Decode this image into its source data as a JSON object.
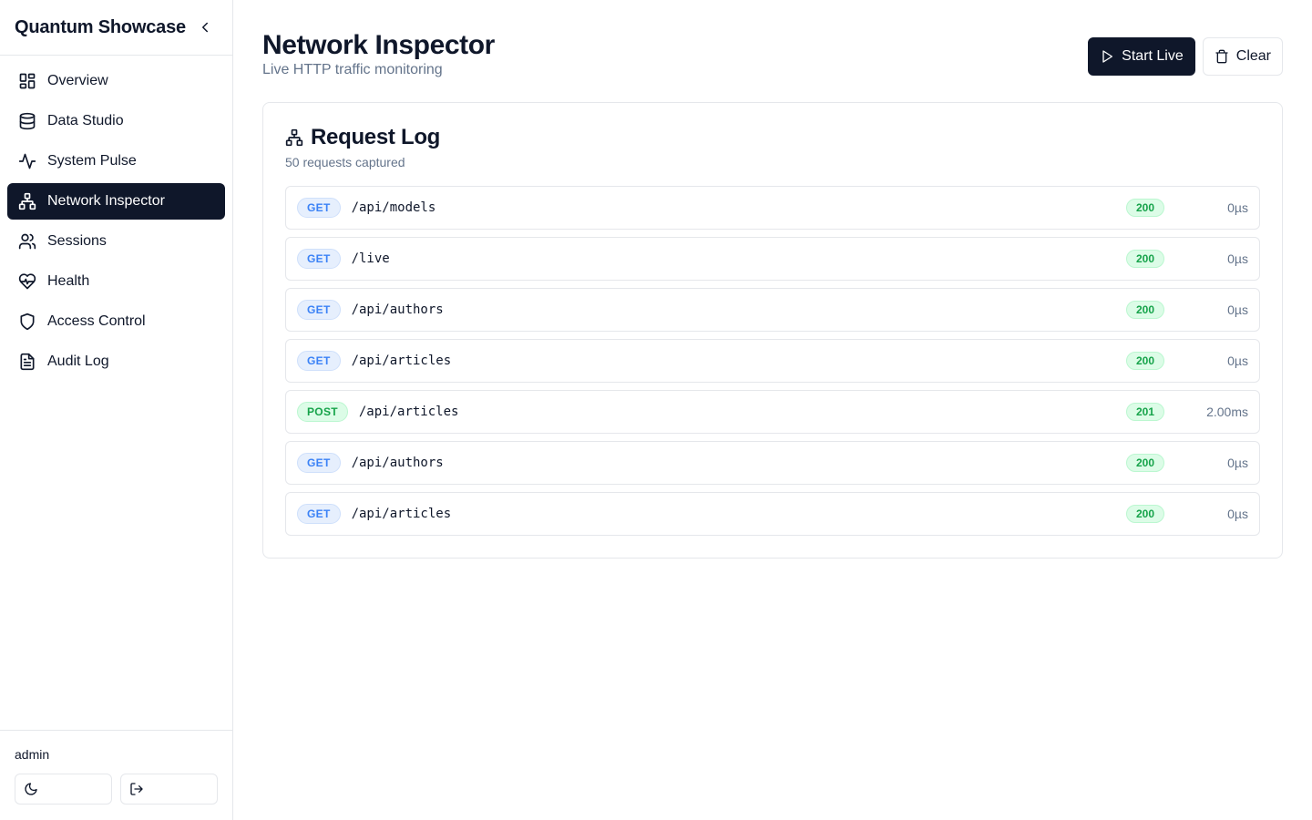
{
  "sidebar": {
    "brand": "Quantum Showcase",
    "items": [
      {
        "label": "Overview",
        "icon": "layout-dashboard-icon",
        "active": false
      },
      {
        "label": "Data Studio",
        "icon": "database-icon",
        "active": false
      },
      {
        "label": "System Pulse",
        "icon": "activity-icon",
        "active": false
      },
      {
        "label": "Network Inspector",
        "icon": "network-icon",
        "active": true
      },
      {
        "label": "Sessions",
        "icon": "users-icon",
        "active": false
      },
      {
        "label": "Health",
        "icon": "heart-pulse-icon",
        "active": false
      },
      {
        "label": "Access Control",
        "icon": "shield-icon",
        "active": false
      },
      {
        "label": "Audit Log",
        "icon": "file-text-icon",
        "active": false
      }
    ],
    "footer": {
      "user": "admin"
    }
  },
  "header": {
    "title": "Network Inspector",
    "subtitle": "Live HTTP traffic monitoring",
    "start_label": "Start Live",
    "clear_label": "Clear"
  },
  "card": {
    "title": "Request Log",
    "subtitle": "50 requests captured",
    "requests": [
      {
        "method": "GET",
        "path": "/api/models",
        "status": "200",
        "duration": "0µs"
      },
      {
        "method": "GET",
        "path": "/live",
        "status": "200",
        "duration": "0µs"
      },
      {
        "method": "GET",
        "path": "/api/authors",
        "status": "200",
        "duration": "0µs"
      },
      {
        "method": "GET",
        "path": "/api/articles",
        "status": "200",
        "duration": "0µs"
      },
      {
        "method": "POST",
        "path": "/api/articles",
        "status": "201",
        "duration": "2.00ms"
      },
      {
        "method": "GET",
        "path": "/api/authors",
        "status": "200",
        "duration": "0µs"
      },
      {
        "method": "GET",
        "path": "/api/articles",
        "status": "200",
        "duration": "0µs"
      }
    ]
  },
  "colors": {
    "primary": "#0f172a",
    "muted": "#64748b",
    "border": "#e5e7eb",
    "get": "#3b82f6",
    "success": "#16a34a"
  }
}
